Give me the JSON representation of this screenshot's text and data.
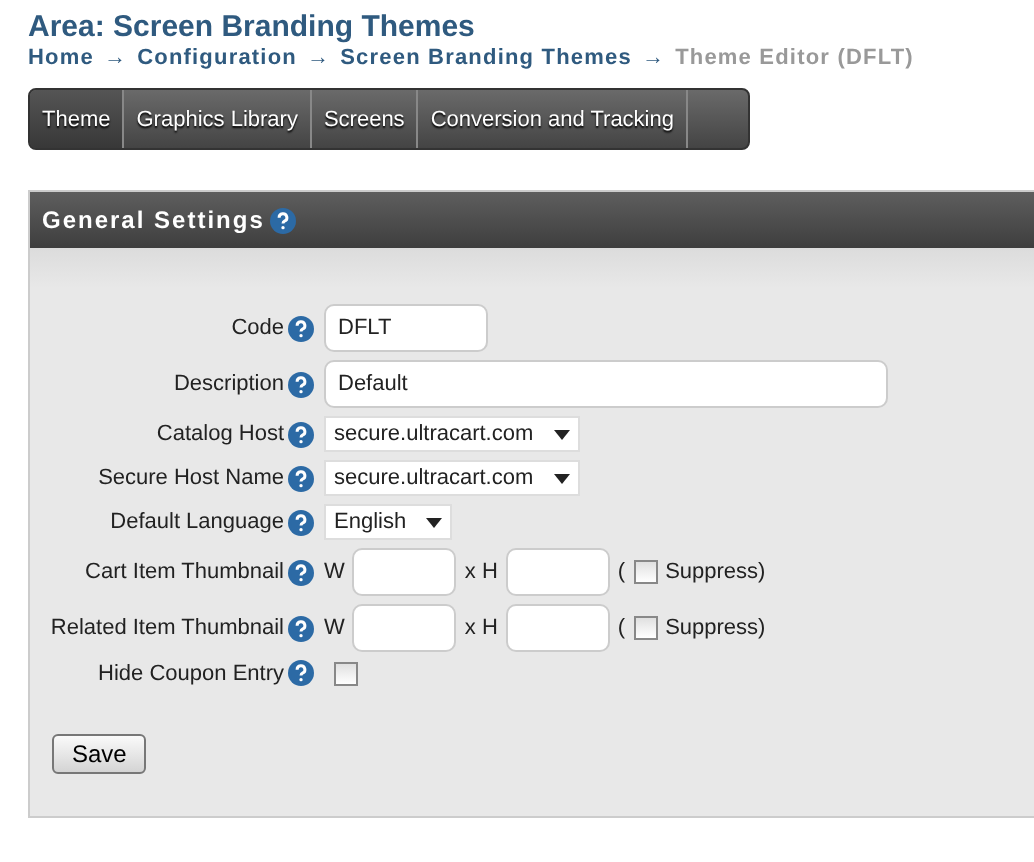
{
  "area_title": "Area: Screen Branding Themes",
  "breadcrumb": [
    {
      "kind": "link",
      "label": "Home"
    },
    {
      "kind": "separator",
      "label": "→"
    },
    {
      "kind": "link",
      "label": "Configuration"
    },
    {
      "kind": "separator",
      "label": "→"
    },
    {
      "kind": "link",
      "label": "Screen Branding Themes"
    },
    {
      "kind": "separator",
      "label": "→"
    },
    {
      "kind": "current",
      "label": "Theme Editor (DFLT)"
    }
  ],
  "tabs": [
    {
      "label": "Theme",
      "selected": true
    },
    {
      "label": "Graphics Library",
      "selected": false
    },
    {
      "label": "Screens",
      "selected": false
    },
    {
      "label": "Conversion and Tracking",
      "selected": false
    }
  ],
  "panel": {
    "title": "General Settings",
    "rows": [
      {
        "kind": "text",
        "label": "Code",
        "value": "DFLT"
      },
      {
        "kind": "widetext",
        "label": "Description",
        "value": "Default"
      },
      {
        "kind": "select",
        "label": "Catalog Host",
        "value": "secure.ultracart.com"
      },
      {
        "kind": "select",
        "label": "Secure Host Name",
        "value": "secure.ultracart.com"
      },
      {
        "kind": "select",
        "label": "Default Language",
        "value": "English"
      },
      {
        "kind": "dimensions",
        "label": "Cart Item Thumbnail",
        "w_label": "W",
        "h_label": "x H",
        "open_paren": "(",
        "suppress_label": "Suppress)",
        "checked": false
      },
      {
        "kind": "dimensions",
        "label": "Related Item Thumbnail",
        "w_label": "W",
        "h_label": "x H",
        "open_paren": "(",
        "suppress_label": "Suppress)",
        "checked": false
      },
      {
        "kind": "checkbox",
        "label": "Hide Coupon Entry",
        "checked": false
      }
    ],
    "save_button": "Save"
  }
}
